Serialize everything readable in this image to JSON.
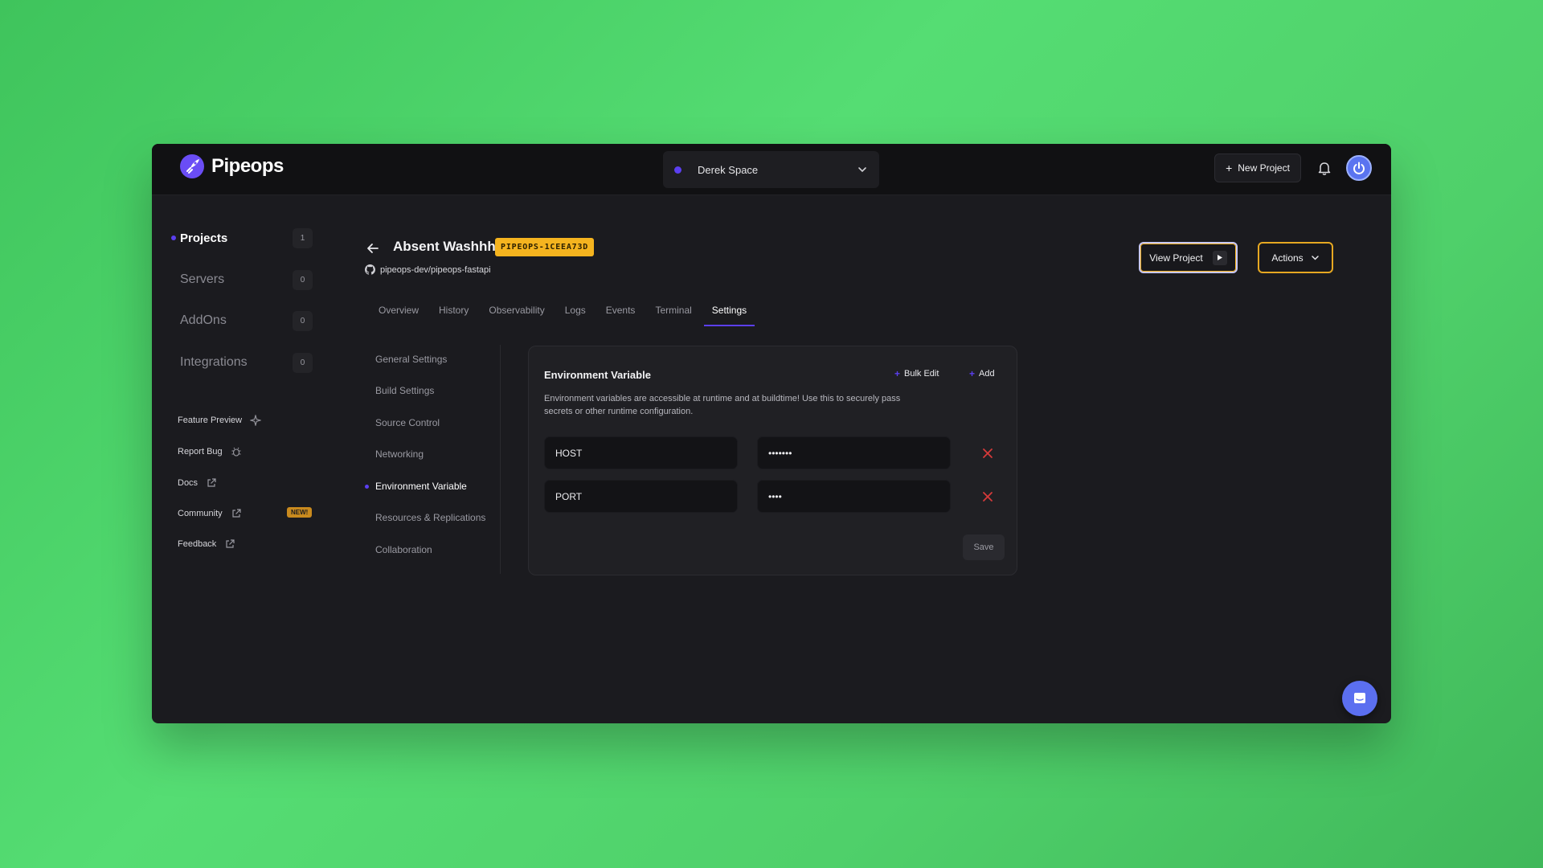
{
  "app": {
    "name": "Pipeops"
  },
  "workspace": {
    "name": "Derek Space"
  },
  "header": {
    "new_project": "New Project"
  },
  "sidebar": {
    "nav": [
      {
        "label": "Projects",
        "count": "1"
      },
      {
        "label": "Servers",
        "count": "0"
      },
      {
        "label": "AddOns",
        "count": "0"
      },
      {
        "label": "Integrations",
        "count": "0"
      }
    ],
    "links": [
      {
        "label": "Feature Preview"
      },
      {
        "label": "Report Bug"
      },
      {
        "label": "Docs"
      },
      {
        "label": "Community",
        "badge": "NEW!"
      },
      {
        "label": "Feedback"
      }
    ]
  },
  "project": {
    "name": "Absent Washhh",
    "id_badge": "PIPEOPS-1CEEA73D",
    "repo": "pipeops-dev/pipeops-fastapi",
    "view_button": "View Project",
    "actions_button": "Actions"
  },
  "tabs": [
    "Overview",
    "History",
    "Observability",
    "Logs",
    "Events",
    "Terminal",
    "Settings"
  ],
  "settings_nav": [
    "General Settings",
    "Build Settings",
    "Source Control",
    "Networking",
    "Environment Variable",
    "Resources & Replications",
    "Collaboration"
  ],
  "env": {
    "title": "Environment Variable",
    "bulk_edit": "Bulk Edit",
    "add": "Add",
    "description": "Environment variables are accessible at runtime and at buildtime! Use this to securely pass secrets or other runtime configuration.",
    "rows": [
      {
        "key": "HOST",
        "value": "•••••••"
      },
      {
        "key": "PORT",
        "value": "••••"
      }
    ],
    "save": "Save"
  },
  "colors": {
    "accent": "#5b3ff0",
    "badge": "#f5b41f",
    "danger": "#d63a3a",
    "background": "#4fd06a"
  }
}
